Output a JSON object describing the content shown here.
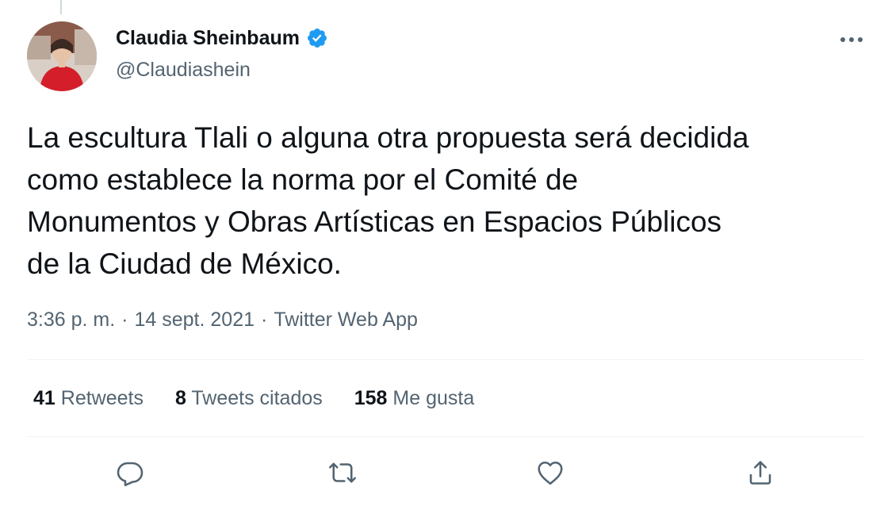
{
  "author": {
    "name": "Claudia Sheinbaum",
    "handle": "@Claudiashein",
    "verified": true
  },
  "tweet": {
    "text_lines": [
      "La escultura Tlali o alguna otra propuesta será decidida",
      "como establece la norma por el Comité de",
      "Monumentos y Obras Artísticas en Espacios Públicos",
      "de la Ciudad de México."
    ],
    "time": "3:36 p. m.",
    "separator": "·",
    "date": "14 sept. 2021",
    "source": "Twitter Web App"
  },
  "stats": {
    "retweets": {
      "count": "41",
      "label": "Retweets"
    },
    "quotes": {
      "count": "8",
      "label": "Tweets citados"
    },
    "likes": {
      "count": "158",
      "label": "Me gusta"
    }
  },
  "actions": [
    {
      "icon": "reply-icon"
    },
    {
      "icon": "retweet-icon"
    },
    {
      "icon": "like-icon"
    },
    {
      "icon": "share-icon"
    }
  ],
  "colors": {
    "text": "#0f1419",
    "secondary": "#536471",
    "verified": "#1d9bf0",
    "divider": "#eff3f4"
  }
}
